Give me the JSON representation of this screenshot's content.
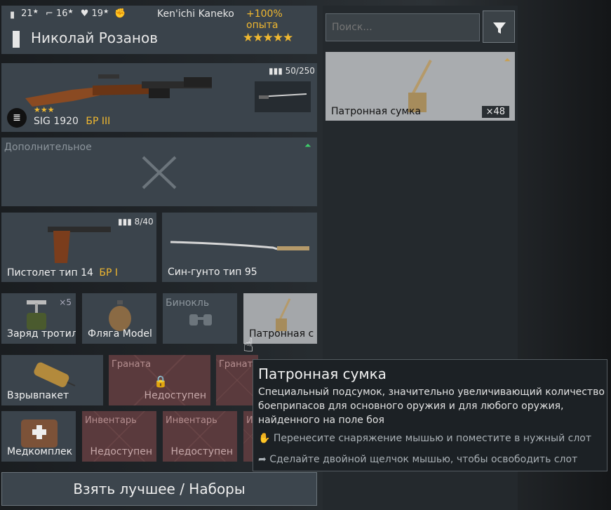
{
  "header": {
    "stat1": "21",
    "stat2": "16",
    "stat3": "19",
    "player": "Ken'ichi Kaneko",
    "bonus": "+100% опыта",
    "soldier_name": "Николай Розанов",
    "stars": "★★★★★"
  },
  "primary": {
    "ammo": "50/250",
    "stars": "★★★",
    "name": "SIG 1920",
    "rank": "БР III"
  },
  "additional": {
    "label": "Дополнительное"
  },
  "secondary": [
    {
      "ammo": "8/40",
      "name": "Пистолет тип 14",
      "rank": "БР I"
    },
    {
      "name": "Син-гунто тип 95"
    }
  ],
  "equipment": [
    {
      "name": "Заряд тротил",
      "count": "×5"
    },
    {
      "name": "Фляга Model"
    },
    {
      "name": "Бинокль"
    },
    {
      "name": "Патронная с"
    }
  ],
  "row5": {
    "item": "Взрывпакет",
    "locked": [
      {
        "title": "Граната",
        "status": "Недоступен"
      },
      {
        "title": "Граната",
        "status": ""
      }
    ]
  },
  "row6": {
    "item": "Медкомплек",
    "locked": [
      {
        "title": "Инвентарь",
        "status": "Недоступен"
      },
      {
        "title": "Инвентарь",
        "status": "Недоступен"
      },
      {
        "title": "И",
        "status": ""
      }
    ]
  },
  "best_button": "Взять лучшее / Наборы",
  "search": {
    "placeholder": "Поиск..."
  },
  "inventory": [
    {
      "name": "Патронная сумка",
      "count": "×48"
    }
  ],
  "tooltip": {
    "title": "Патронная сумка",
    "description": "Специальный подсумок, значительно увеличивающий количество боеприпасов для основного оружия и для любого оружия, найденного на поле боя",
    "hint1": "Перенесите снаряжение мышью и поместите в нужный слот",
    "hint2": "Сделайте двойной щелчок мышью, чтобы освободить слот"
  },
  "colors": {
    "gold": "#f0b830",
    "locked": "#5a3a3d",
    "panel": "#3a434b"
  }
}
